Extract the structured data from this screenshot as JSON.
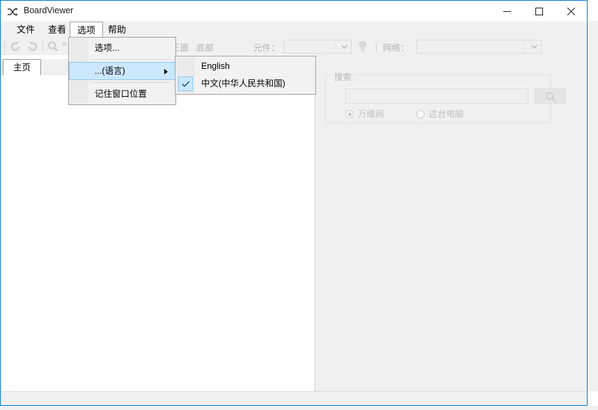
{
  "window": {
    "title": "BoardViewer",
    "app_icon": "shuffle-icon",
    "controls": {
      "minimize": "minimize-icon",
      "maximize": "maximize-icon",
      "close": "close-icon"
    },
    "border_color": "#0078d7"
  },
  "menubar": {
    "items": [
      {
        "label": "文件",
        "open": false
      },
      {
        "label": "查看",
        "open": false
      },
      {
        "label": "选项",
        "open": true
      },
      {
        "label": "帮助",
        "open": false
      }
    ]
  },
  "toolbar": {
    "icons": [
      {
        "name": "rotate-left-icon",
        "enabled": false
      },
      {
        "name": "rotate-right-icon",
        "enabled": false
      },
      {
        "name": "zoom-icon",
        "enabled": false
      },
      {
        "name": "fit-to-screen-icon",
        "enabled": false
      }
    ],
    "view_buttons": [
      {
        "label": "正面"
      },
      {
        "label": "底部"
      }
    ],
    "component_label": "元件：",
    "component_value": "",
    "net_label": "网络：",
    "net_value": "",
    "bulb_icon": "lightbulb-icon"
  },
  "tabs": [
    {
      "label": "主页",
      "active": true
    }
  ],
  "search_panel": {
    "title": "搜索",
    "input_value": "",
    "input_placeholder": "",
    "button_icon": "search-icon",
    "radios": [
      {
        "label": "万维网",
        "selected": true
      },
      {
        "label": "这台电脑",
        "selected": false
      }
    ]
  },
  "dropdown_menu": {
    "items": [
      {
        "label": "选项...",
        "highlighted": false,
        "has_submenu": false
      },
      {
        "separator": true
      },
      {
        "label": "...(语言)",
        "highlighted": true,
        "has_submenu": true
      },
      {
        "separator": true
      },
      {
        "label": "记住窗口位置",
        "highlighted": false,
        "has_submenu": false
      }
    ]
  },
  "submenu": {
    "items": [
      {
        "label": "English",
        "checked": false
      },
      {
        "label": "中文(中华人民共和国)",
        "checked": true
      }
    ]
  },
  "statusbar": {
    "text": ""
  }
}
